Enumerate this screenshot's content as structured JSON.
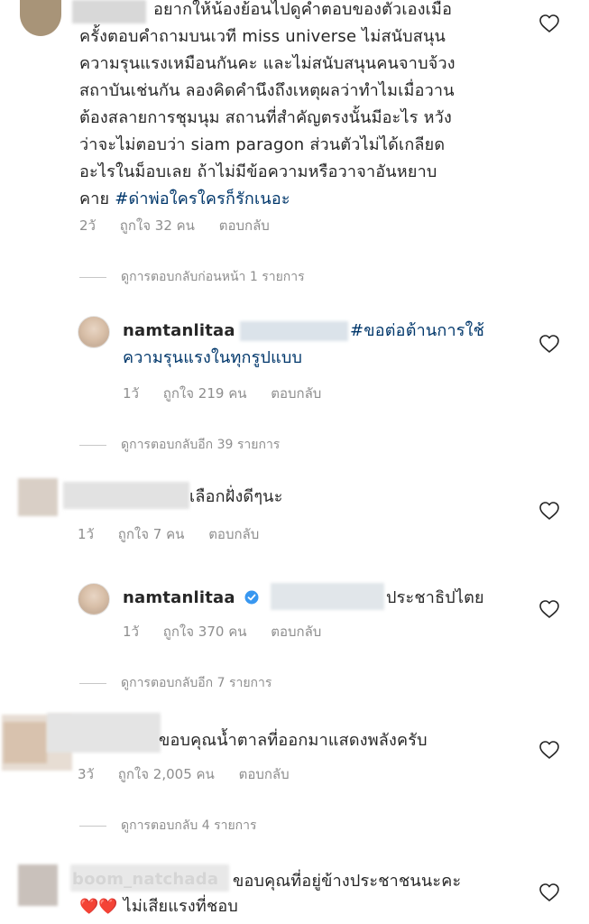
{
  "comments": [
    {
      "lines": [
        "อยากให้น้องย้อนไปดูคำตอบของตัวเองเมื่อ",
        "ครั้งตอบคำถามบนเวที miss universe ไม่สนับสนุน",
        "ความรุนแรงเหมือนกันคะ และไม่สนับสนุนคนจาบจ้วง",
        "สถาบันเช่นกัน ลองคิดคำนึงถึงเหตุผลว่าทำไมเมื่อวาน",
        "ต้องสลายการชุมนุม สถานที่สำคัญตรงนั้นมีอะไร หวัง",
        "ว่าจะไม่ตอบว่า siam paragon ส่วนตัวไม่ได้เกลียด",
        "อะไรในม็อบเลย ถ้าไม่มีข้อความหรือวาจาอันหยาบ"
      ],
      "last_prefix": "คาย ",
      "last_hashtag": "#ด่าพ่อใครใครก็รักเนอะ",
      "time": "2วั",
      "likes": "ถูกใจ 32 คน",
      "reply": "ตอบกลับ"
    }
  ],
  "view_prev_1": "ดูการตอบกลับก่อนหน้า 1 รายการ",
  "reply1": {
    "username": "namtanlitaa",
    "hashtag_line1": "#ขอต่อต้านการใช้",
    "hashtag_line2": "ความรุนแรงในทุกรูปแบบ",
    "time": "1วั",
    "likes": "ถูกใจ 219 คน",
    "reply": "ตอบกลับ"
  },
  "view_more_39": "ดูการตอบกลับอีก 39 รายการ",
  "comment2": {
    "text": "เลือกฝั่งดีๆนะ",
    "time": "1วั",
    "likes": "ถูกใจ 7 คน",
    "reply": "ตอบกลับ"
  },
  "reply2": {
    "username": "namtanlitaa",
    "text": "ประชาธิปไตย",
    "time": "1วั",
    "likes": "ถูกใจ 370 คน",
    "reply": "ตอบกลับ"
  },
  "view_more_7": "ดูการตอบกลับอีก 7 รายการ",
  "comment3": {
    "text": "ขอบคุณน้ำตาลที่ออกมาแสดงพลังครับ",
    "time": "3วั",
    "likes": "ถูกใจ 2,005 คน",
    "reply": "ตอบกลับ"
  },
  "view_more_4": "ดูการตอบกลับ 4 รายการ",
  "comment4": {
    "username": "boom_natchada",
    "text_line1": "ขอบคุณที่อยู่ข้างประชาชนนะคะ",
    "text_line2": "ไม่เสียแรงที่ชอบ",
    "hearts": "❤️❤️"
  },
  "colors": {
    "text": "#262626",
    "meta": "#8e8e8e",
    "hashtag": "#00376b",
    "verified": "#3897f0"
  }
}
